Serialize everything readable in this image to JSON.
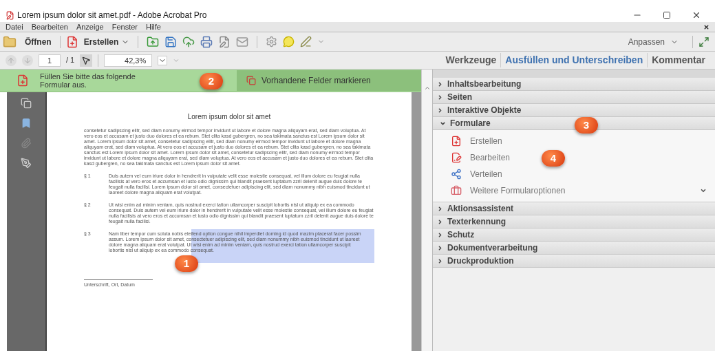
{
  "window": {
    "title": "Lorem ipsum dolor sit amet.pdf - Adobe Acrobat Pro"
  },
  "menu": [
    {
      "label": "Datei"
    },
    {
      "label": "Bearbeiten"
    },
    {
      "label": "Anzeige"
    },
    {
      "label": "Fenster"
    },
    {
      "label": "Hilfe"
    }
  ],
  "toolbar": {
    "open": "Öffnen",
    "create": "Erstellen",
    "customize": "Anpassen"
  },
  "nav": {
    "page": "1",
    "page_total": "/ 1",
    "zoom": "42,3%",
    "tabs": [
      {
        "label": "Werkzeuge",
        "selected": false
      },
      {
        "label": "Ausfüllen und Unterschreiben",
        "selected": true
      },
      {
        "label": "Kommentar",
        "selected": false
      }
    ]
  },
  "banner": {
    "message": "Füllen Sie bitte das folgende Formular aus.",
    "button": "Vorhandene Felder markieren"
  },
  "document": {
    "title": "Lorem ipsum dolor sit amet",
    "intro": "consetetur sadipscing elitr, sed diam nonumy eirmod tempor invidunt ut labore et dolore magna aliquyam erat, sed diam voluptua. At vero eos et accusam et justo duo dolores et ea rebum. Stet clita kasd gubergren, no sea takimata sanctus est Lorem ipsum dolor sit amet. Lorem ipsum dolor sit amet, consetetur sadipscing elitr, sed diam nonumy eirmod tempor invidunt ut labore et dolore magna aliquyam erat, sed diam voluptua. At vero eos et accusam et justo duo dolores et ea rebum. Stet clita kasd gubergren, no sea takimata sanctus est Lorem ipsum dolor sit amet. Lorem ipsum dolor sit amet, consetetur sadipscing elitr, sed diam nonumy eirmod tempor invidunt ut labore et dolore magna aliquyam erat, sed diam voluptua. At vero eos et accusam et justo duo dolores et ea rebum. Stet clita kasd gubergren, no sea takimata sanctus est Lorem ipsum dolor sit amet.",
    "sections": [
      {
        "number": "§ 1",
        "text": "Duis autem vel eum iriure dolor in hendrerit in vulputate velit esse molestie consequat, vel illum dolore eu feugiat nulla facilisis at vero eros et accumsan et iusto odio dignissim qui blandit praesent luptatum zzril delenit augue duis dolore te feugait nulla facilisi. Lorem ipsum dolor sit amet, consectetuer adipiscing elit, sed diam nonummy nibh euismod tincidunt ut laoreet dolore magna aliquam erat volutpat.",
        "highlighted": false
      },
      {
        "number": "§ 2",
        "text": "Ut wisi enim ad minim veniam, quis nostrud exerci tation ullamcorper suscipit lobortis nisl ut aliquip ex ea commodo consequat. Duis autem vel eum iriure dolor in hendrerit in vulputate velit esse molestie consequat, vel illum dolore eu feugiat nulla facilisis at vero eros et accumsan et iusto odio dignissim qui blandit praesent luptatum zzril delenit augue duis dolore te feugait nulla facilisi.",
        "highlighted": false
      },
      {
        "number": "§ 3",
        "text": "Nam liber tempor cum soluta nobis eleifend option congue nihil imperdiet doming id quod mazim placerat facer possim assum. Lorem ipsum dolor sit amet, consectetuer adipiscing elit, sed diam nonummy nibh euismod tincidunt ut laoreet dolore magna aliquam erat volutpat. Ut wisi enim ad minim veniam, quis nostrud exerci tation ullamcorper suscipit lobortis nisl ut aliquip ex ea commodo consequat.",
        "highlighted": true
      }
    ],
    "signature": "Unterschrift, Ort, Datum"
  },
  "panel": {
    "sections": [
      {
        "label": "Inhaltsbearbeitung",
        "expanded": false
      },
      {
        "label": "Seiten",
        "expanded": false
      },
      {
        "label": "Interaktive Objekte",
        "expanded": false
      },
      {
        "label": "Formulare",
        "expanded": true,
        "items": [
          {
            "label": "Erstellen",
            "kind": "create"
          },
          {
            "label": "Bearbeiten",
            "kind": "edit"
          },
          {
            "label": "Verteilen",
            "kind": "distribute"
          },
          {
            "label": "Weitere Formularoptionen",
            "kind": "more"
          }
        ]
      },
      {
        "label": "Aktionsassistent",
        "expanded": false
      },
      {
        "label": "Texterkennung",
        "expanded": false
      },
      {
        "label": "Schutz",
        "expanded": false
      },
      {
        "label": "Dokumentverarbeitung",
        "expanded": false
      },
      {
        "label": "Druckproduktion",
        "expanded": false
      }
    ]
  },
  "callouts": [
    {
      "label": "1"
    },
    {
      "label": "2"
    },
    {
      "label": "3"
    },
    {
      "label": "4"
    }
  ]
}
